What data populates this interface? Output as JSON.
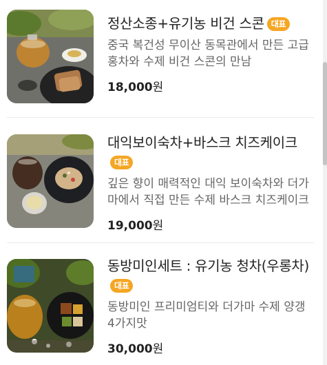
{
  "products": [
    {
      "title": "정산소종+유기농 비건 스콘",
      "badge": "대표",
      "description": "중국 복건성 무이산 동목관에서 만든 고급홍차와 수제 비건 스콘의 만남",
      "price": "18,000",
      "currency": "원",
      "image": "tea-scone-photo"
    },
    {
      "title": "대익보이숙차+바스크 치즈케이크",
      "badge": "대표",
      "description": "깊은 향이 매력적인 대익 보이숙차와 더가마에서 직접 만든 수제 바스크 치즈케이크",
      "price": "19,000",
      "currency": "원",
      "image": "puer-cheesecake-photo"
    },
    {
      "title": "동방미인세트 : 유기농 청차(우롱차)",
      "badge": "대표",
      "description": "동방미인 프리미엄티와 더가마 수제 양갱 4가지맛",
      "price": "30,000",
      "currency": "원",
      "image": "oolong-set-photo"
    }
  ]
}
